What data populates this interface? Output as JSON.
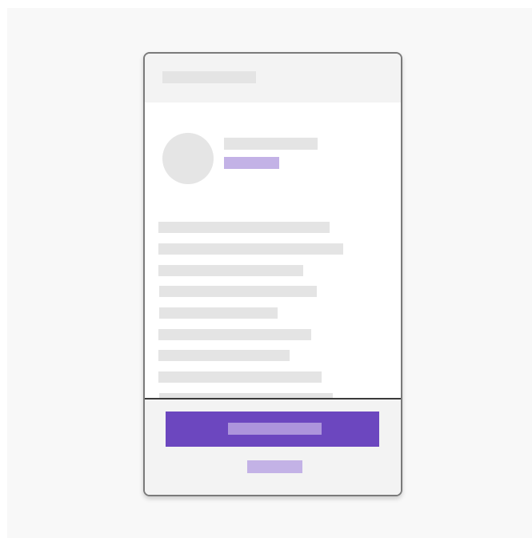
{
  "screen": {
    "type": "mobile-profile-skeleton",
    "state": "loading-placeholders"
  },
  "colors": {
    "page_background": "#f8f8f8",
    "placeholder_gray": "#e4e4e4",
    "accent": "#6c47bf",
    "accent_light": "#c3b2e6",
    "button_label_placeholder": "#ad95dc",
    "header_footer_background": "#f3f3f3",
    "frame_border": "#7a7a7a"
  },
  "header": {
    "title_placeholder": true
  },
  "profile": {
    "avatar": "avatar-placeholder",
    "name_placeholder": true,
    "tag_placeholder": true
  },
  "body": {
    "text_line_count": 9
  },
  "footer": {
    "primary_action_placeholder": true,
    "secondary_action_placeholder": true
  }
}
